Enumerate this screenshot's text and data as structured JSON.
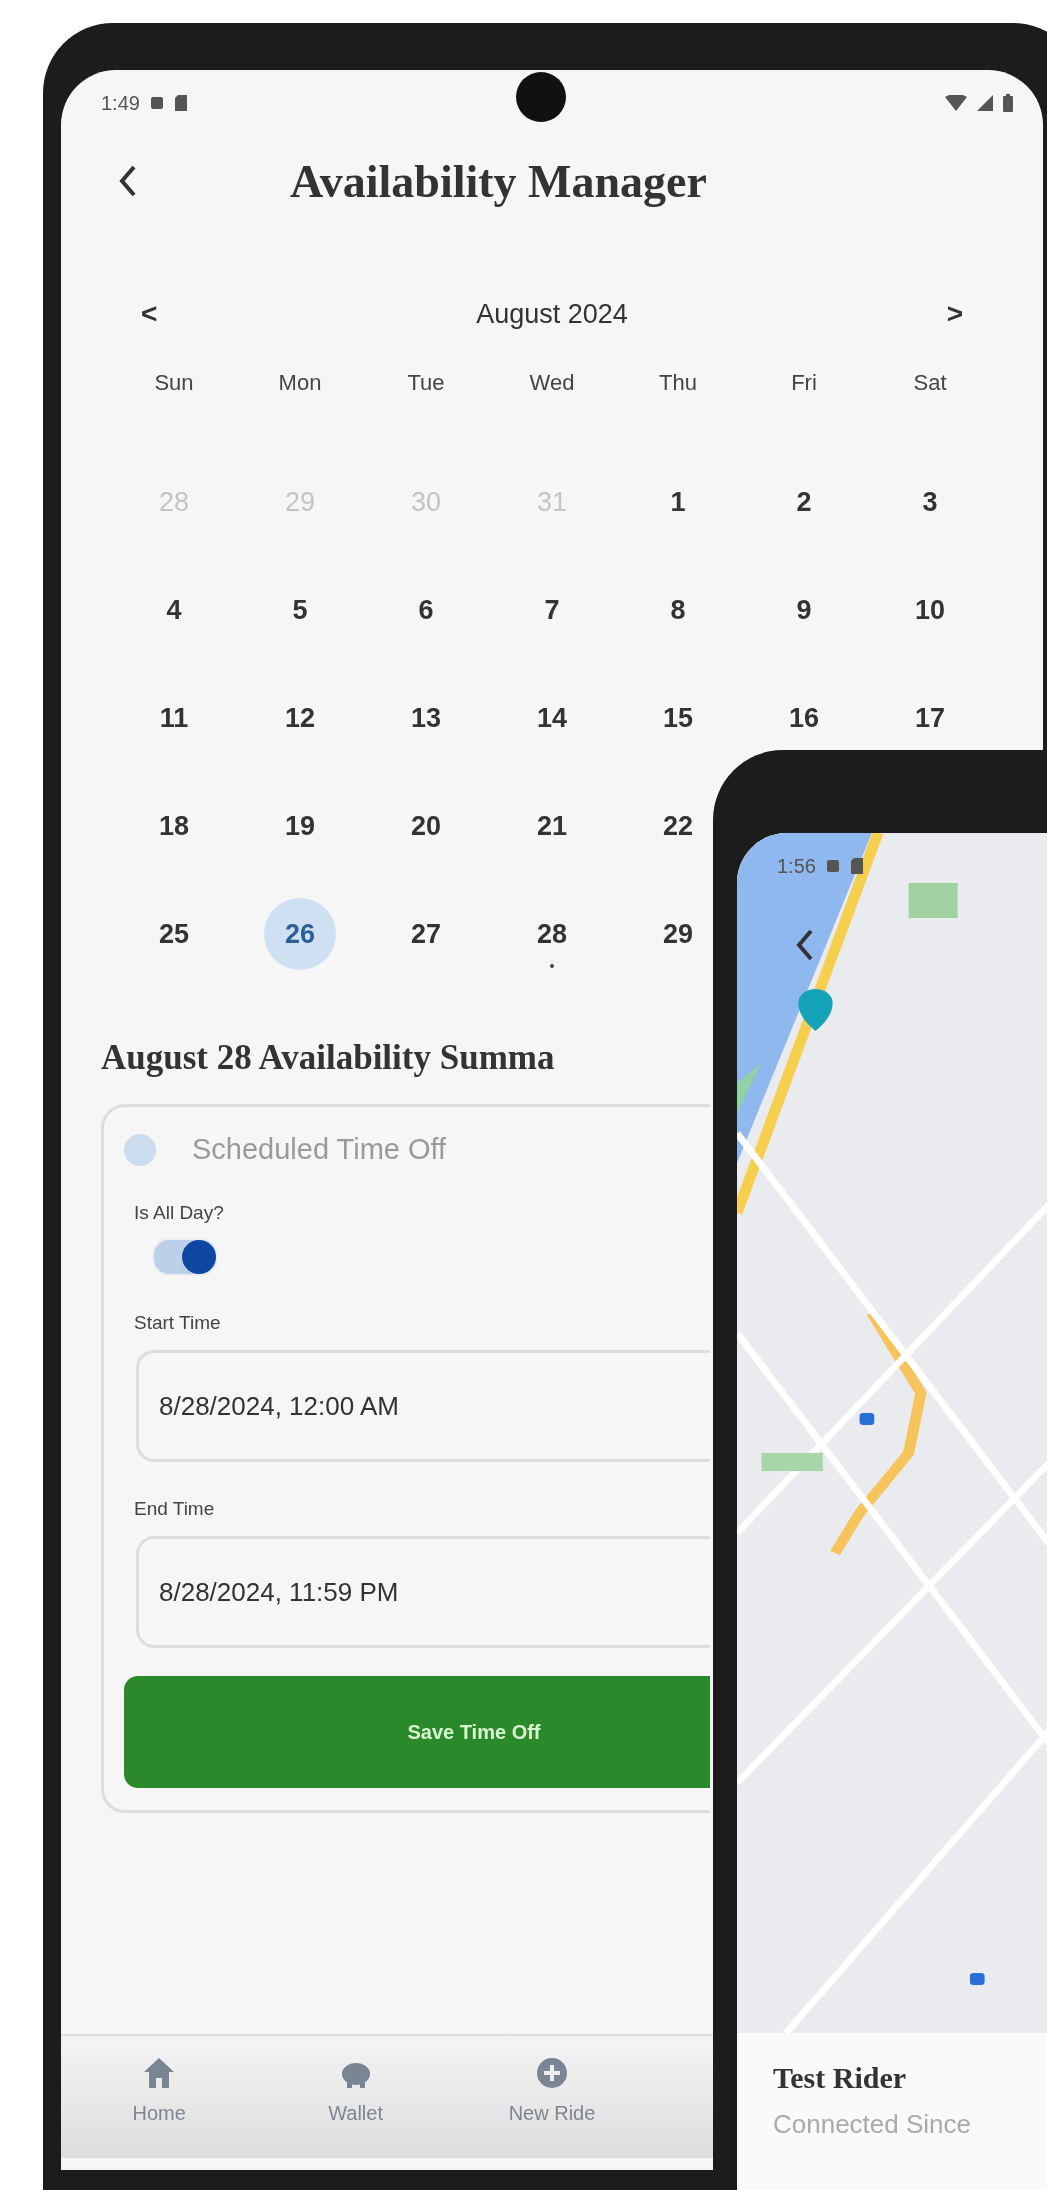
{
  "availability_screen": {
    "status_bar": {
      "time": "1:49"
    },
    "title": "Availability Manager",
    "calendar": {
      "prev": "<",
      "month": "August 2024",
      "next": ">",
      "weekdays": [
        "Sun",
        "Mon",
        "Tue",
        "Wed",
        "Thu",
        "Fri",
        "Sat"
      ],
      "weeks": [
        [
          {
            "day": "28",
            "outside": true,
            "selected": false,
            "marked": false
          },
          {
            "day": "29",
            "outside": true,
            "selected": false,
            "marked": false
          },
          {
            "day": "30",
            "outside": true,
            "selected": false,
            "marked": false
          },
          {
            "day": "31",
            "outside": true,
            "selected": false,
            "marked": false
          },
          {
            "day": "1",
            "outside": false,
            "selected": false,
            "marked": false
          },
          {
            "day": "2",
            "outside": false,
            "selected": false,
            "marked": false
          },
          {
            "day": "3",
            "outside": false,
            "selected": false,
            "marked": false
          }
        ],
        [
          {
            "day": "4",
            "outside": false,
            "selected": false,
            "marked": false
          },
          {
            "day": "5",
            "outside": false,
            "selected": false,
            "marked": false
          },
          {
            "day": "6",
            "outside": false,
            "selected": false,
            "marked": false
          },
          {
            "day": "7",
            "outside": false,
            "selected": false,
            "marked": false
          },
          {
            "day": "8",
            "outside": false,
            "selected": false,
            "marked": false
          },
          {
            "day": "9",
            "outside": false,
            "selected": false,
            "marked": false
          },
          {
            "day": "10",
            "outside": false,
            "selected": false,
            "marked": false
          }
        ],
        [
          {
            "day": "11",
            "outside": false,
            "selected": false,
            "marked": false
          },
          {
            "day": "12",
            "outside": false,
            "selected": false,
            "marked": false
          },
          {
            "day": "13",
            "outside": false,
            "selected": false,
            "marked": false
          },
          {
            "day": "14",
            "outside": false,
            "selected": false,
            "marked": false
          },
          {
            "day": "15",
            "outside": false,
            "selected": false,
            "marked": false
          },
          {
            "day": "16",
            "outside": false,
            "selected": false,
            "marked": false
          },
          {
            "day": "17",
            "outside": false,
            "selected": false,
            "marked": false
          }
        ],
        [
          {
            "day": "18",
            "outside": false,
            "selected": false,
            "marked": false
          },
          {
            "day": "19",
            "outside": false,
            "selected": false,
            "marked": false
          },
          {
            "day": "20",
            "outside": false,
            "selected": false,
            "marked": false
          },
          {
            "day": "21",
            "outside": false,
            "selected": false,
            "marked": false
          },
          {
            "day": "22",
            "outside": false,
            "selected": false,
            "marked": false
          }
        ],
        [
          {
            "day": "25",
            "outside": false,
            "selected": false,
            "marked": false
          },
          {
            "day": "26",
            "outside": false,
            "selected": true,
            "marked": false
          },
          {
            "day": "27",
            "outside": false,
            "selected": false,
            "marked": false
          },
          {
            "day": "28",
            "outside": false,
            "selected": false,
            "marked": true
          },
          {
            "day": "29",
            "outside": false,
            "selected": false,
            "marked": false
          }
        ]
      ]
    },
    "summary": {
      "heading": "August 28 Availability Summa",
      "option": {
        "label": "Scheduled Time Off",
        "checked": false
      },
      "all_day": {
        "label": "Is All Day?",
        "on": true
      },
      "start": {
        "label": "Start Time",
        "value": "8/28/2024, 12:00 AM"
      },
      "end": {
        "label": "End Time",
        "value": "8/28/2024, 11:59 PM"
      },
      "button": "Save Time Off"
    },
    "bottom_nav": [
      {
        "kind": "home",
        "label": "Home"
      },
      {
        "kind": "wallet",
        "label": "Wallet"
      },
      {
        "kind": "add",
        "label": "New Ride"
      }
    ]
  },
  "ride_screen": {
    "status_bar": {
      "time": "1:56"
    },
    "rider": {
      "name": "Test Rider",
      "status": "Connected Since"
    }
  }
}
